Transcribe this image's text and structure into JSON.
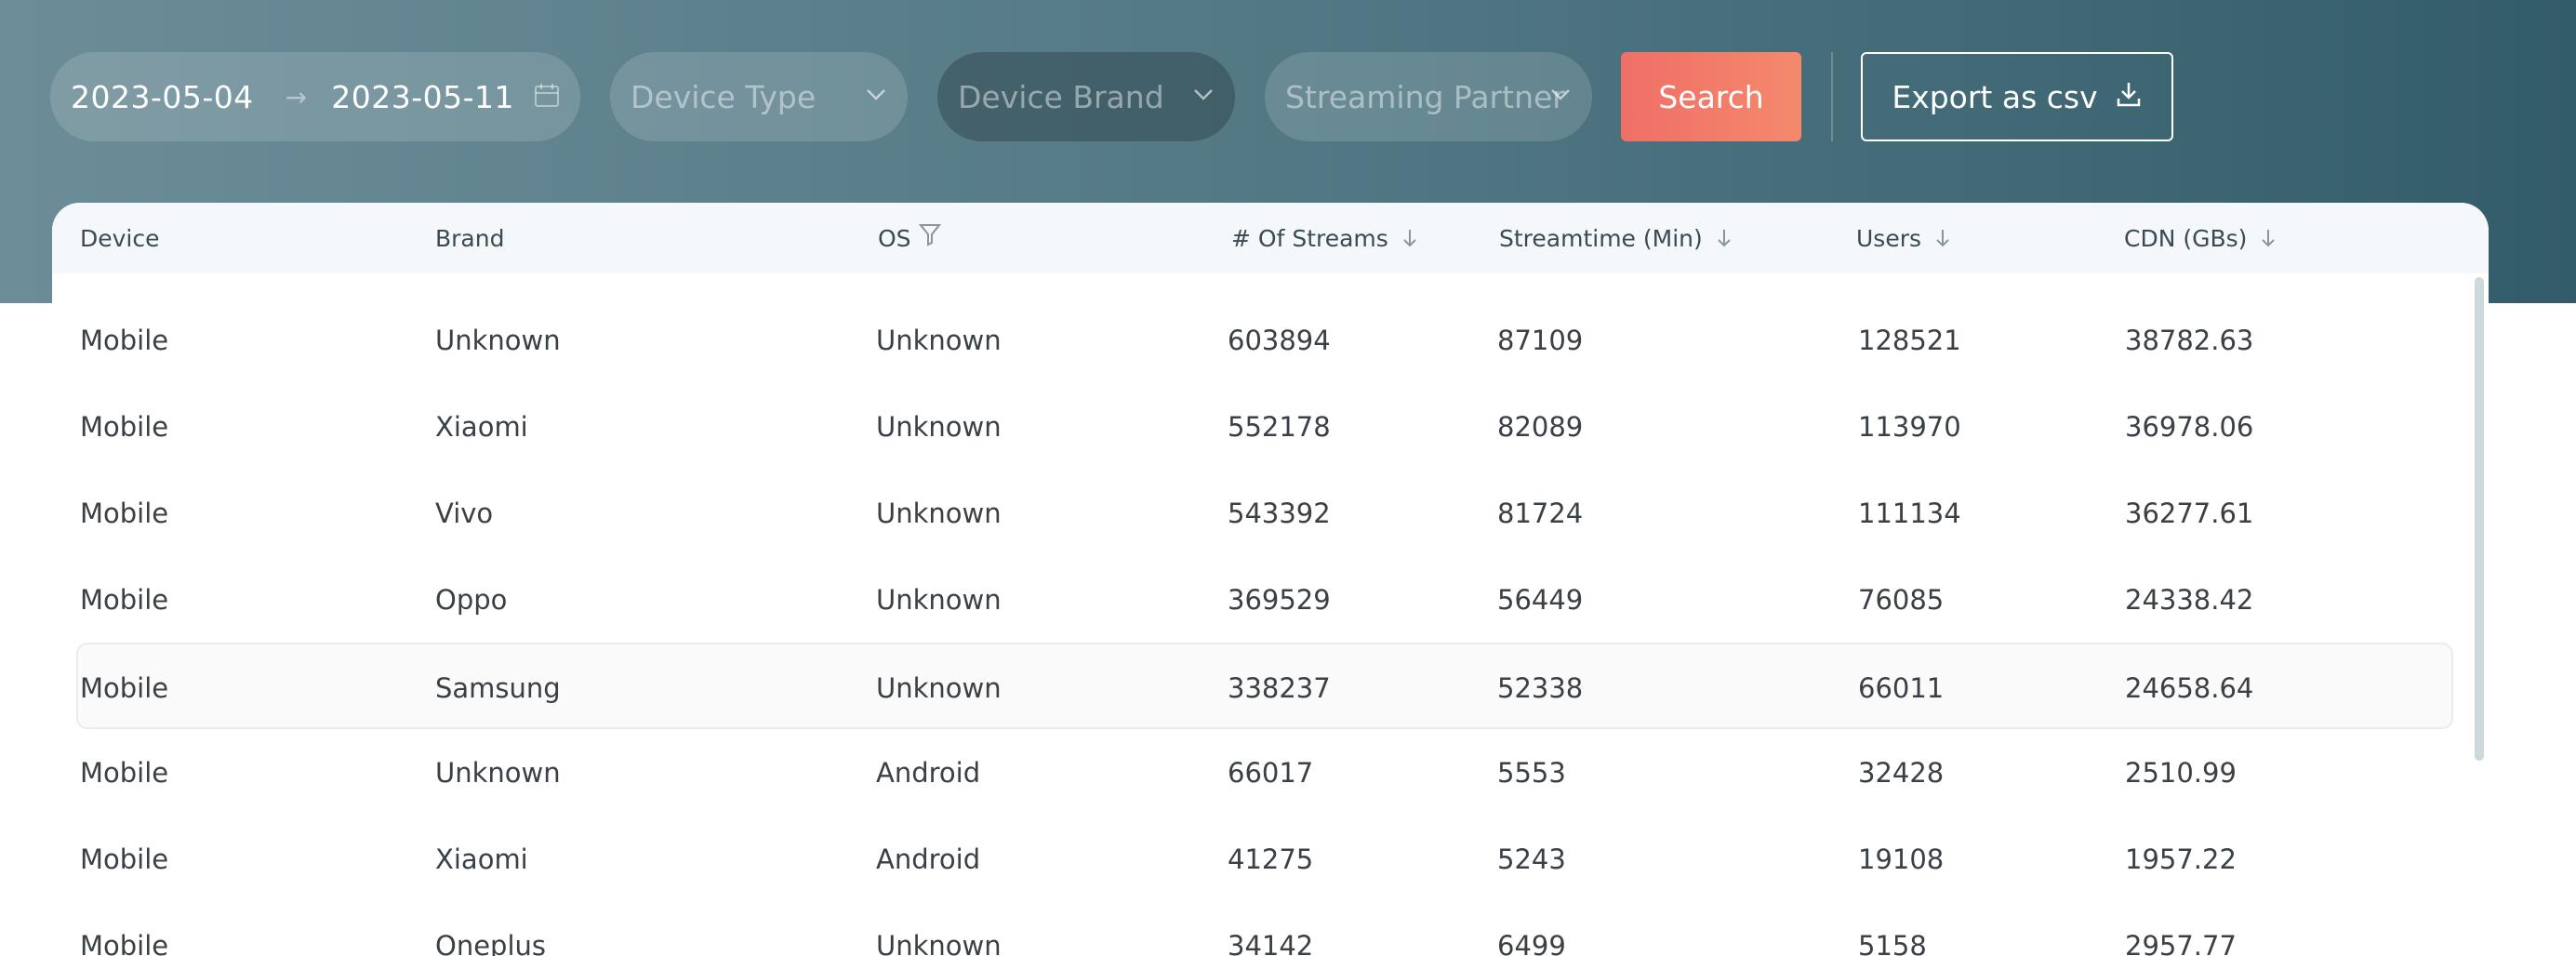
{
  "filters": {
    "date_start": "2023-05-04",
    "date_end": "2023-05-11",
    "device_type_placeholder": "Device Type",
    "device_brand_placeholder": "Device Brand",
    "streaming_partner_placeholder": "Streaming Partner",
    "search_label": "Search",
    "export_label": "Export as csv"
  },
  "colors": {
    "accent": "#f07a68",
    "header_gradient_start": "#6c8d98",
    "header_gradient_end": "#335c6a"
  },
  "table": {
    "columns": [
      {
        "label": "Device",
        "sortable": false,
        "filterable": false
      },
      {
        "label": "Brand",
        "sortable": false,
        "filterable": false
      },
      {
        "label": "OS",
        "sortable": false,
        "filterable": true
      },
      {
        "label": "# Of Streams",
        "sortable": true,
        "filterable": false
      },
      {
        "label": "Streamtime (Min)",
        "sortable": true,
        "filterable": false
      },
      {
        "label": "Users",
        "sortable": true,
        "filterable": false
      },
      {
        "label": "CDN (GBs)",
        "sortable": true,
        "filterable": false
      }
    ],
    "rows": [
      [
        "Mobile",
        "Unknown",
        "Unknown",
        "603894",
        "87109",
        "128521",
        "38782.63"
      ],
      [
        "Mobile",
        "Xiaomi",
        "Unknown",
        "552178",
        "82089",
        "113970",
        "36978.06"
      ],
      [
        "Mobile",
        "Vivo",
        "Unknown",
        "543392",
        "81724",
        "111134",
        "36277.61"
      ],
      [
        "Mobile",
        "Oppo",
        "Unknown",
        "369529",
        "56449",
        "76085",
        "24338.42"
      ],
      [
        "Mobile",
        "Samsung",
        "Unknown",
        "338237",
        "52338",
        "66011",
        "24658.64"
      ],
      [
        "Mobile",
        "Unknown",
        "Android",
        "66017",
        "5553",
        "32428",
        "2510.99"
      ],
      [
        "Mobile",
        "Xiaomi",
        "Android",
        "41275",
        "5243",
        "19108",
        "1957.22"
      ],
      [
        "Mobile",
        "Oneplus",
        "Unknown",
        "34142",
        "6499",
        "5158",
        "2957.77"
      ]
    ]
  }
}
